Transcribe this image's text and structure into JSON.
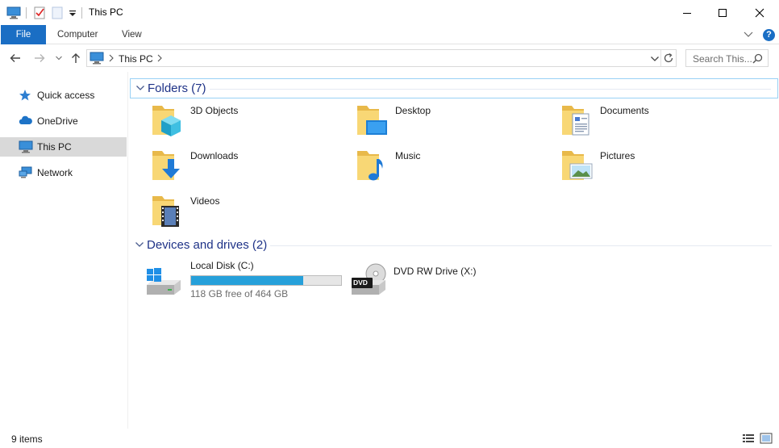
{
  "window": {
    "title": "This PC",
    "controls": {
      "minimize": "—",
      "maximize": "□",
      "close": "✕"
    }
  },
  "ribbon": {
    "tabs": [
      "File",
      "Computer",
      "View"
    ],
    "help_glyph": "?"
  },
  "address": {
    "path": [
      "This PC"
    ],
    "search_placeholder": "Search This..."
  },
  "sidebar": {
    "items": [
      {
        "label": "Quick access",
        "icon": "star-icon"
      },
      {
        "label": "OneDrive",
        "icon": "cloud-icon"
      },
      {
        "label": "This PC",
        "icon": "computer-icon",
        "selected": true
      },
      {
        "label": "Network",
        "icon": "network-icon"
      }
    ]
  },
  "folders": {
    "header": "Folders (7)",
    "items": [
      {
        "name": "3D Objects",
        "icon": "3d-objects-icon"
      },
      {
        "name": "Desktop",
        "icon": "desktop-icon"
      },
      {
        "name": "Documents",
        "icon": "documents-icon"
      },
      {
        "name": "Downloads",
        "icon": "downloads-icon"
      },
      {
        "name": "Music",
        "icon": "music-icon"
      },
      {
        "name": "Pictures",
        "icon": "pictures-icon"
      },
      {
        "name": "Videos",
        "icon": "videos-icon"
      }
    ]
  },
  "drives": {
    "header": "Devices and drives (2)",
    "items": [
      {
        "name": "Local Disk (C:)",
        "free_text": "118 GB free of 464 GB",
        "used_fraction": 0.746,
        "icon": "windows-drive-icon"
      },
      {
        "name": "DVD RW Drive (X:)",
        "icon": "dvd-drive-icon",
        "badge": "DVD"
      }
    ]
  },
  "status": {
    "item_count": "9 items"
  },
  "colors": {
    "accent": "#1a6ec4",
    "group_title": "#1e3287",
    "progress": "#26a0da",
    "selected": "#d9d9d9"
  }
}
